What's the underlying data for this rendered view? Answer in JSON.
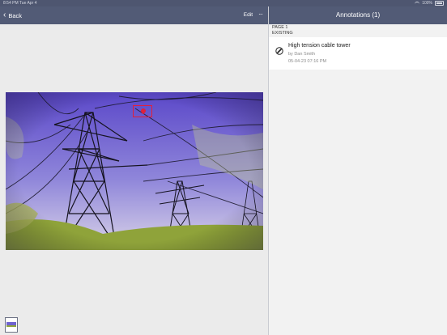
{
  "status_bar": {
    "time": "8:54 PM  Tue Apr 4",
    "battery": "100%"
  },
  "nav": {
    "back_label": "Back",
    "edit_label": "Edit",
    "more_label": "···"
  },
  "annotations_panel": {
    "title": "Annotations (1)",
    "section": {
      "page": "PAGE 1",
      "group": "EXISTING"
    },
    "items": [
      {
        "title": "High tension cable tower",
        "author": "by Dan Smith",
        "date": "05-04-23 07:16 PM",
        "icon": "pen-icon"
      }
    ]
  },
  "colors": {
    "nav_bar": "#525b76",
    "marker": "#e0203a",
    "sky": "#7a6fd6",
    "grass": "#8fa33a"
  }
}
